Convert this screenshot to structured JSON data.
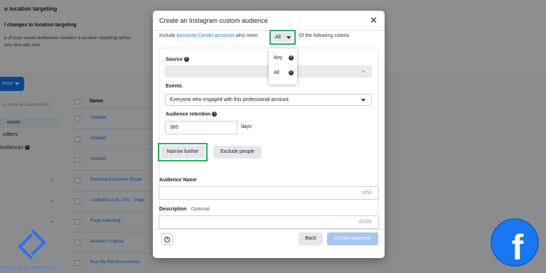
{
  "background": {
    "banner_title": "o location targeting",
    "banner_subtitle": "l changes to location targeting",
    "banner_line1": "e of your saved audiences contains a location targeting option",
    "banner_line2": "any new ads sets.",
    "banner_line3": "",
    "create_button_label": "ence",
    "search_placeholder": "y name or audience ID",
    "sidebar_items": [
      {
        "label": "ences"
      },
      {
        "label": "cribers"
      },
      {
        "label": "Audiences"
      }
    ],
    "table_header": "Name",
    "rows": [
      {
        "name": "Untitled"
      },
      {
        "name": "Untitled"
      },
      {
        "name": "Untitled"
      },
      {
        "name": "Persona Customer Email"
      },
      {
        "name": "Lookalike (US, 1%) - Page"
      },
      {
        "name": "Page watching"
      },
      {
        "name": "Aviation Virginia"
      },
      {
        "name": "Buy My Pet Accessories"
      }
    ]
  },
  "modal": {
    "title": "Create an Instagram custom audience",
    "close_glyph": "✕",
    "include_prefix": "Include",
    "include_link": "Accounts Center accounts",
    "include_mid": "who meet",
    "include_suffix": "Of the following criteria",
    "match_selected": "All",
    "match_options": [
      {
        "label": "Any"
      },
      {
        "label": "All"
      }
    ],
    "source_label": "Source",
    "source_value": "",
    "events_label": "Events",
    "events_value": "Everyone who engaged with this professional account",
    "retention_label": "Audience retention",
    "retention_value": "365",
    "retention_unit": "days",
    "narrow_button": "Narrow further",
    "exclude_button": "Exclude people",
    "name_label": "Audience Name",
    "name_counter": "0/50",
    "description_label": "Description",
    "description_optional": "· Optional",
    "description_counter": "0/100",
    "help_glyph": "?",
    "back_button": "Back",
    "create_button": "Create audience"
  },
  "logos": {
    "watermark_caption": "SKILLS OF ALL ACCOUNTS",
    "facebook_letter": "f",
    "facebook_color": "#1877f2",
    "highlight_color": "#22b35e"
  }
}
